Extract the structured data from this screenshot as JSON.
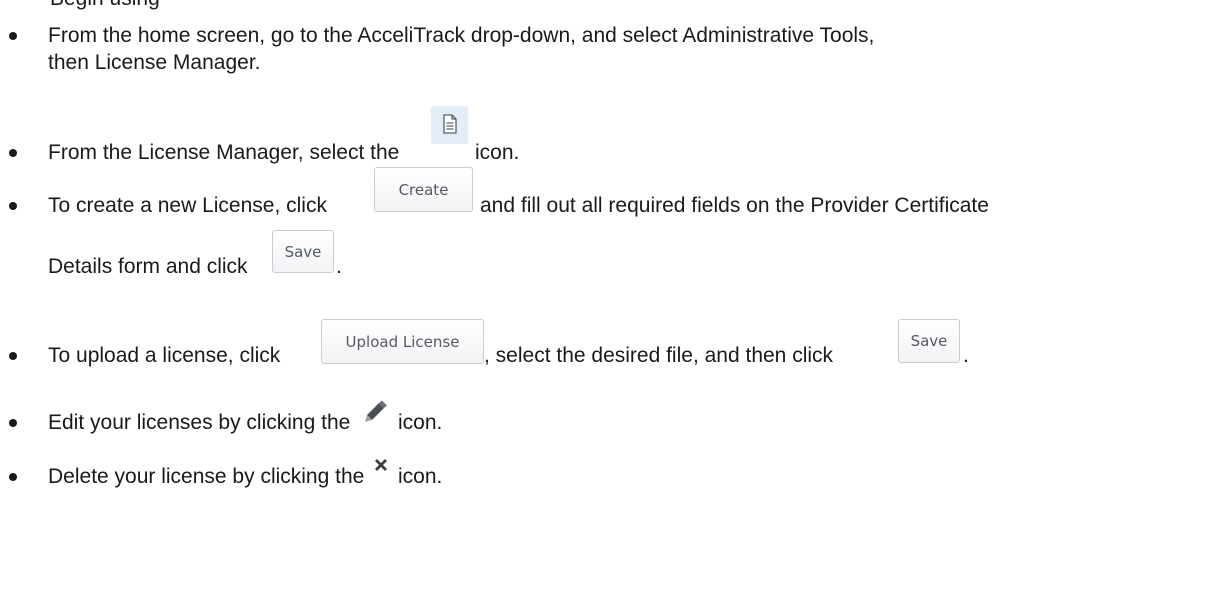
{
  "top_fragment": "Begin using",
  "steps": [
    {
      "line1": "From the home screen, go to the AcceliTrack drop-down, and select Administrative Tools,",
      "line2": "then License Manager."
    },
    {
      "before": "From the License Manager, select the",
      "icon": "document-icon",
      "after": "icon."
    },
    {
      "before": "To create a new License, click",
      "button": "Create",
      "after": "and fill out all required fields on the Provider Certificate",
      "line2_before": "Details form and click",
      "button2": "Save",
      "line2_after": "."
    },
    {
      "before": "To upload a license, click",
      "button": "Upload License",
      "middle": ", select the desired file, and then click",
      "button2": "Save",
      "after": "."
    },
    {
      "before": "Edit your licenses by clicking the",
      "icon": "pencil-icon",
      "after": "icon."
    },
    {
      "before": "Delete your license by clicking the",
      "icon": "close-icon",
      "after": "icon."
    }
  ]
}
